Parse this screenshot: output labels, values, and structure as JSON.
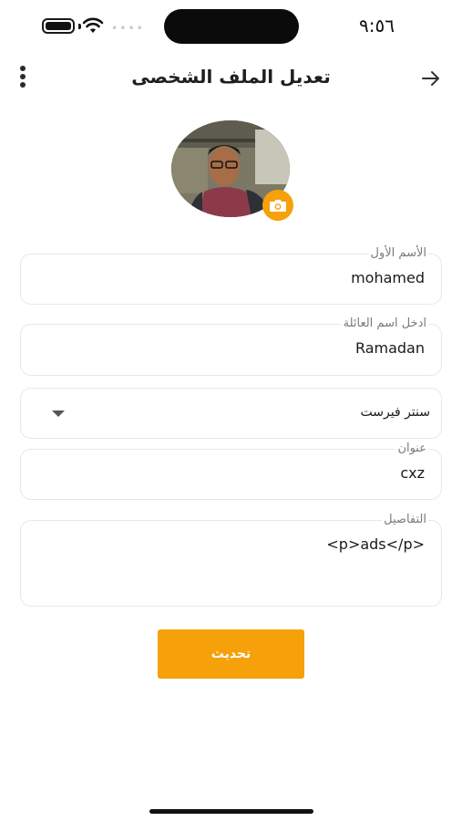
{
  "status_bar": {
    "time": "٩:٥٦",
    "signal_dots": "••••",
    "icons": [
      "battery-icon",
      "wifi-icon",
      "signal-icon"
    ]
  },
  "header": {
    "title": "تعديل الملف الشخصى",
    "icons": [
      "more-vertical-icon",
      "arrow-right-icon"
    ]
  },
  "avatar": {
    "icon": "camera-icon"
  },
  "form": {
    "first_name": {
      "label": "الأسم الأول",
      "value": "mohamed"
    },
    "last_name": {
      "label": "ادخل اسم العائلة",
      "value": "Ramadan"
    },
    "branch": {
      "value": "سنتر فيرست",
      "icon": "caret-down-icon"
    },
    "address": {
      "label": "عنوان",
      "value": "cxz"
    },
    "details": {
      "label": "التفاصيل",
      "value": "<p>ads</p>"
    }
  },
  "actions": {
    "update_label": "تحديث"
  },
  "colors": {
    "accent": "#f6a10a",
    "field_border": "#e8e8e8",
    "label": "#7a7a7a",
    "text": "#1a1a1a"
  }
}
